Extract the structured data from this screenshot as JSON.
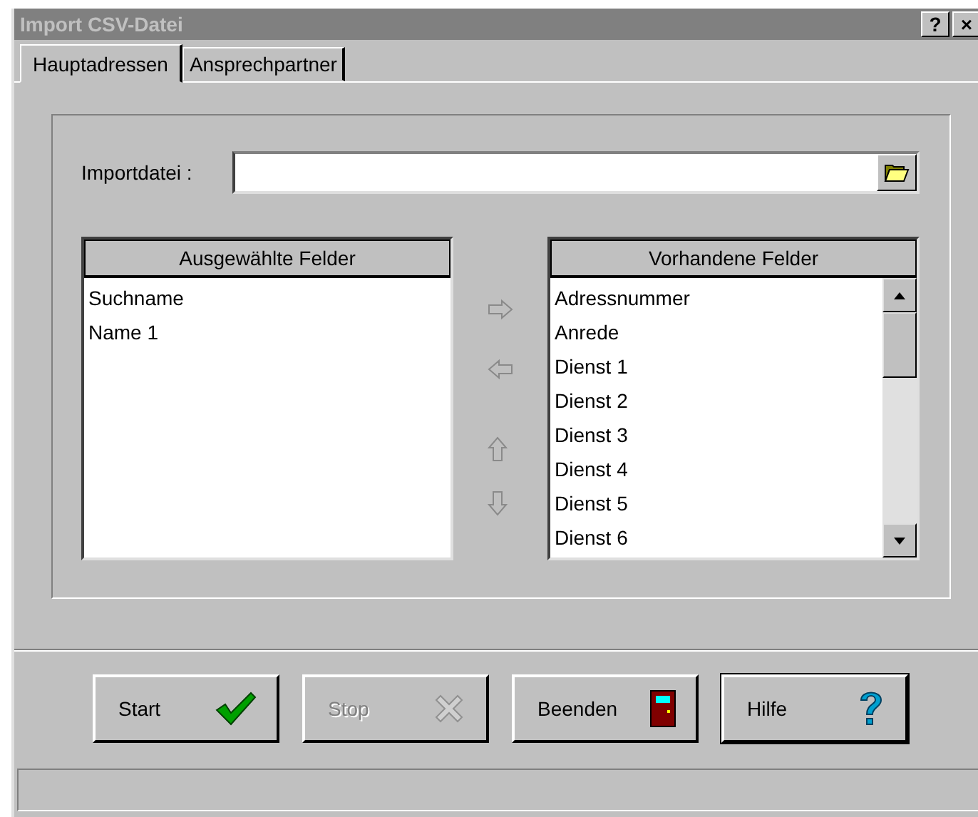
{
  "window": {
    "title": "Import CSV-Datei",
    "title_buttons": [
      "?",
      "×"
    ]
  },
  "tabs": [
    {
      "label": "Hauptadressen",
      "selected": true
    },
    {
      "label": "Ansprechpartner",
      "selected": false
    }
  ],
  "import_file": {
    "label": "Importdatei :"
  },
  "selected_fields": {
    "header": "Ausgewählte Felder",
    "items": [
      "Suchname",
      "Name 1"
    ]
  },
  "move_buttons": [
    {
      "kind": "right",
      "disabled": true
    },
    {
      "kind": "left",
      "disabled": true
    },
    {
      "kind": "up",
      "disabled": true
    },
    {
      "kind": "down",
      "disabled": true
    }
  ],
  "available_fields": {
    "header": "Vorhandene Felder",
    "items": [
      "Adressnummer",
      "Anrede",
      "Dienst 1",
      "Dienst 2",
      "Dienst 3",
      "Dienst 4",
      "Dienst 5",
      "Dienst 6"
    ]
  },
  "buttons": [
    {
      "label": "Start",
      "kind": "start",
      "disabled": false,
      "default": false
    },
    {
      "label": "Stop",
      "kind": "stop",
      "disabled": true,
      "default": false
    },
    {
      "label": "Beenden",
      "kind": "exit",
      "disabled": false,
      "default": false
    },
    {
      "label": "Hilfe",
      "kind": "help",
      "disabled": false,
      "default": true
    }
  ]
}
